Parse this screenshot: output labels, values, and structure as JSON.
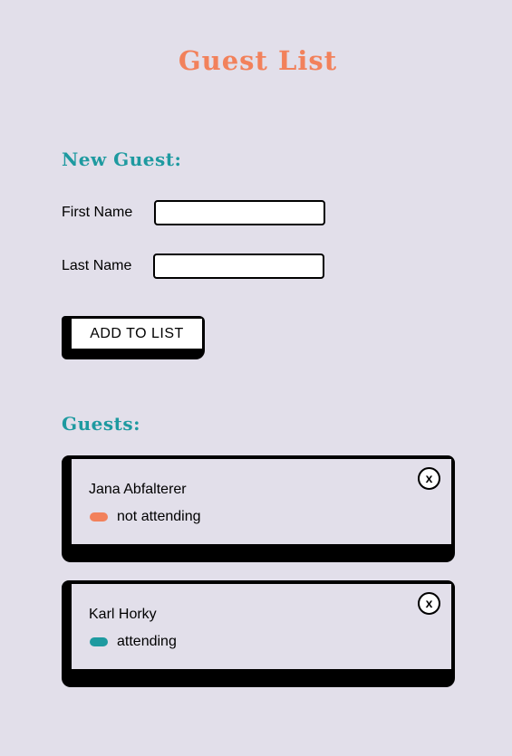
{
  "app": {
    "title": "Guest List"
  },
  "form": {
    "heading": "New Guest:",
    "first_name_label": "First Name",
    "first_name_value": "",
    "last_name_label": "Last Name",
    "last_name_value": "",
    "submit_label": "ADD TO LIST"
  },
  "guests": {
    "heading": "Guests:",
    "remove_label": "x",
    "items": [
      {
        "name": "Jana Abfalterer",
        "status": "not attending",
        "status_color": "#f2815b"
      },
      {
        "name": "Karl Horky",
        "status": "attending",
        "status_color": "#1e9aa0"
      }
    ]
  },
  "colors": {
    "background": "#e2dfea",
    "title": "#f2815b",
    "heading": "#1e9aa0",
    "border": "#000000"
  }
}
